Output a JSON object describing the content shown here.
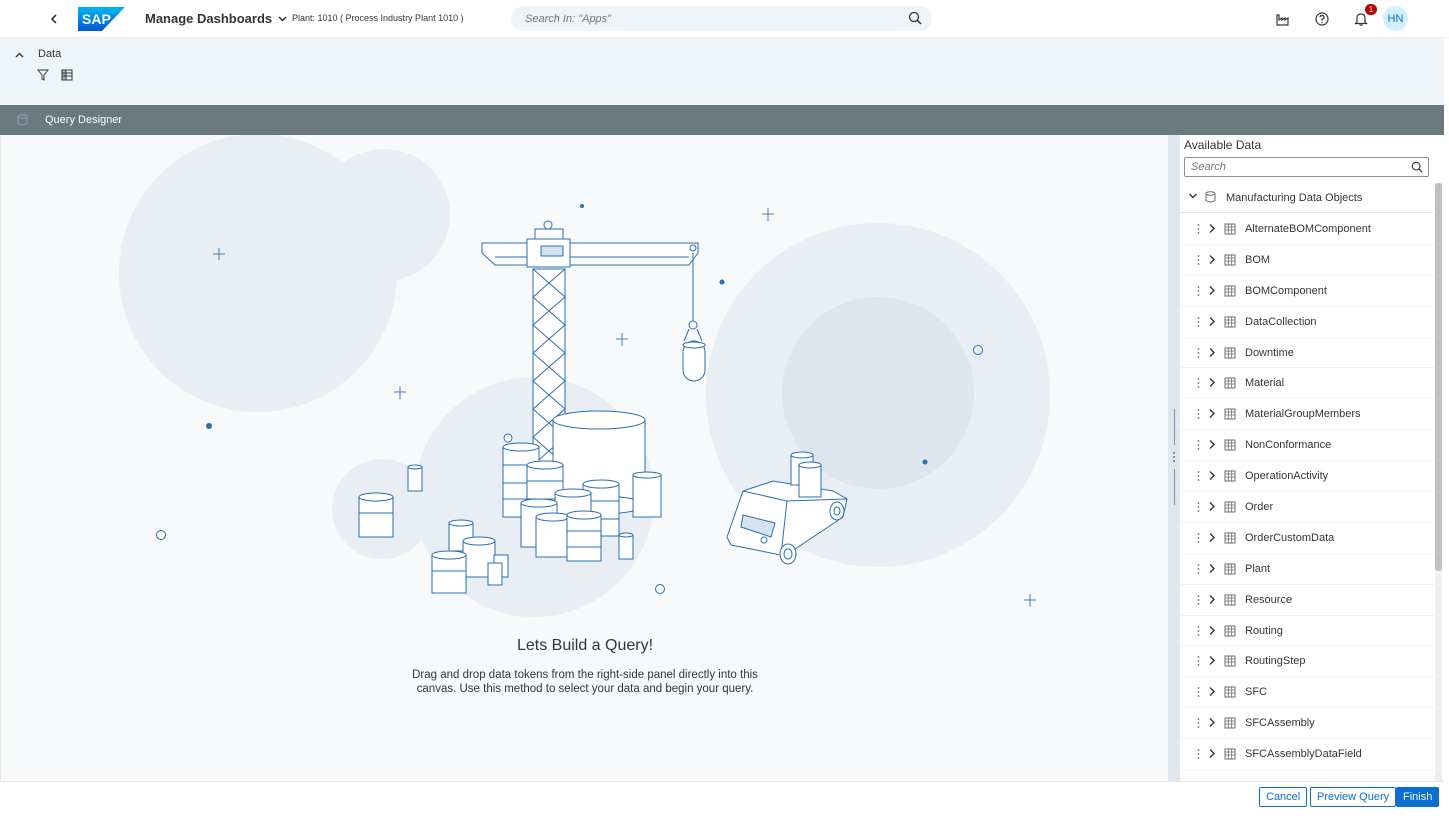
{
  "shell": {
    "back_icon": "chevron-left-icon",
    "logo_text": "SAP",
    "app_title": "Manage Dashboards",
    "plant": "Plant: 1010 ( Process Industry Plant 1010 )",
    "search_placeholder": "Search In: \"Apps\"",
    "notification_count": "1",
    "avatar": "HN",
    "colors": {
      "brand": "#0a6ed1",
      "badge": "#bb0000"
    }
  },
  "data_bar": {
    "label": "Data"
  },
  "query_designer": {
    "title": "Query Designer"
  },
  "canvas": {
    "title": "Lets Build a Query!",
    "text": "Drag and drop data tokens from the right-side panel directly into this canvas. Use this method to select your data and begin your query."
  },
  "panel": {
    "title": "Available Data",
    "search_placeholder": "Search",
    "root": "Manufacturing Data Objects",
    "items": [
      "AlternateBOMComponent",
      "BOM",
      "BOMComponent",
      "DataCollection",
      "Downtime",
      "Material",
      "MaterialGroupMembers",
      "NonConformance",
      "OperationActivity",
      "Order",
      "OrderCustomData",
      "Plant",
      "Resource",
      "Routing",
      "RoutingStep",
      "SFC",
      "SFCAssembly",
      "SFCAssemblyDataField"
    ]
  },
  "footer": {
    "cancel": "Cancel",
    "preview": "Preview Query",
    "finish": "Finish"
  }
}
